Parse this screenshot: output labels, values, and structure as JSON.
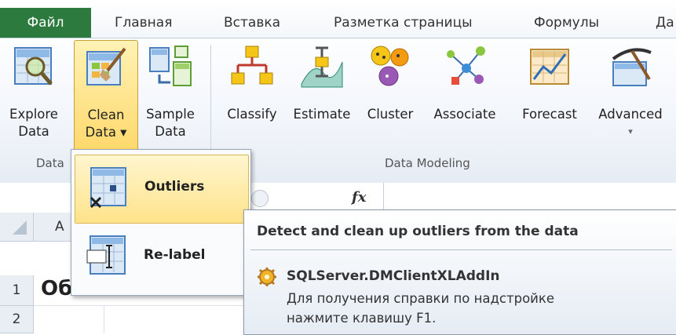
{
  "tabs": {
    "file": "Файл",
    "items": [
      "Главная",
      "Вставка",
      "Разметка страницы",
      "Формулы",
      "Да"
    ]
  },
  "ribbon": {
    "buttons": {
      "explore": {
        "line1": "Explore",
        "line2": "Data"
      },
      "clean": {
        "line1": "Clean",
        "line2": "Data ▾"
      },
      "sample": {
        "line1": "Sample",
        "line2": "Data"
      },
      "classify": {
        "line1": "Classify"
      },
      "estimate": {
        "line1": "Estimate"
      },
      "cluster": {
        "line1": "Cluster"
      },
      "associate": {
        "line1": "Associate"
      },
      "forecast": {
        "line1": "Forecast"
      },
      "advanced": {
        "line1": "Advanced",
        "line2": "▾"
      }
    },
    "groups": {
      "data_prep": "Data",
      "data_modeling": "Data Modeling"
    }
  },
  "formula_bar": {
    "fx": "fx"
  },
  "sheet": {
    "col_a": "A",
    "rows": [
      {
        "num": "1",
        "cell": "Об"
      },
      {
        "num": "2",
        "cell": ""
      }
    ]
  },
  "dropdown": {
    "items": [
      {
        "label": "Outliers"
      },
      {
        "label": "Re-label"
      }
    ]
  },
  "tooltip": {
    "title": "Detect and clean up outliers from the data",
    "addin": "SQLServer.DMClientXLAddIn",
    "help_line1": "Для получения справки по надстройке",
    "help_line2": "нажмите клавишу F1."
  },
  "colors": {
    "file_tab": "#2c7a3d",
    "hover": "#ffe38a"
  }
}
